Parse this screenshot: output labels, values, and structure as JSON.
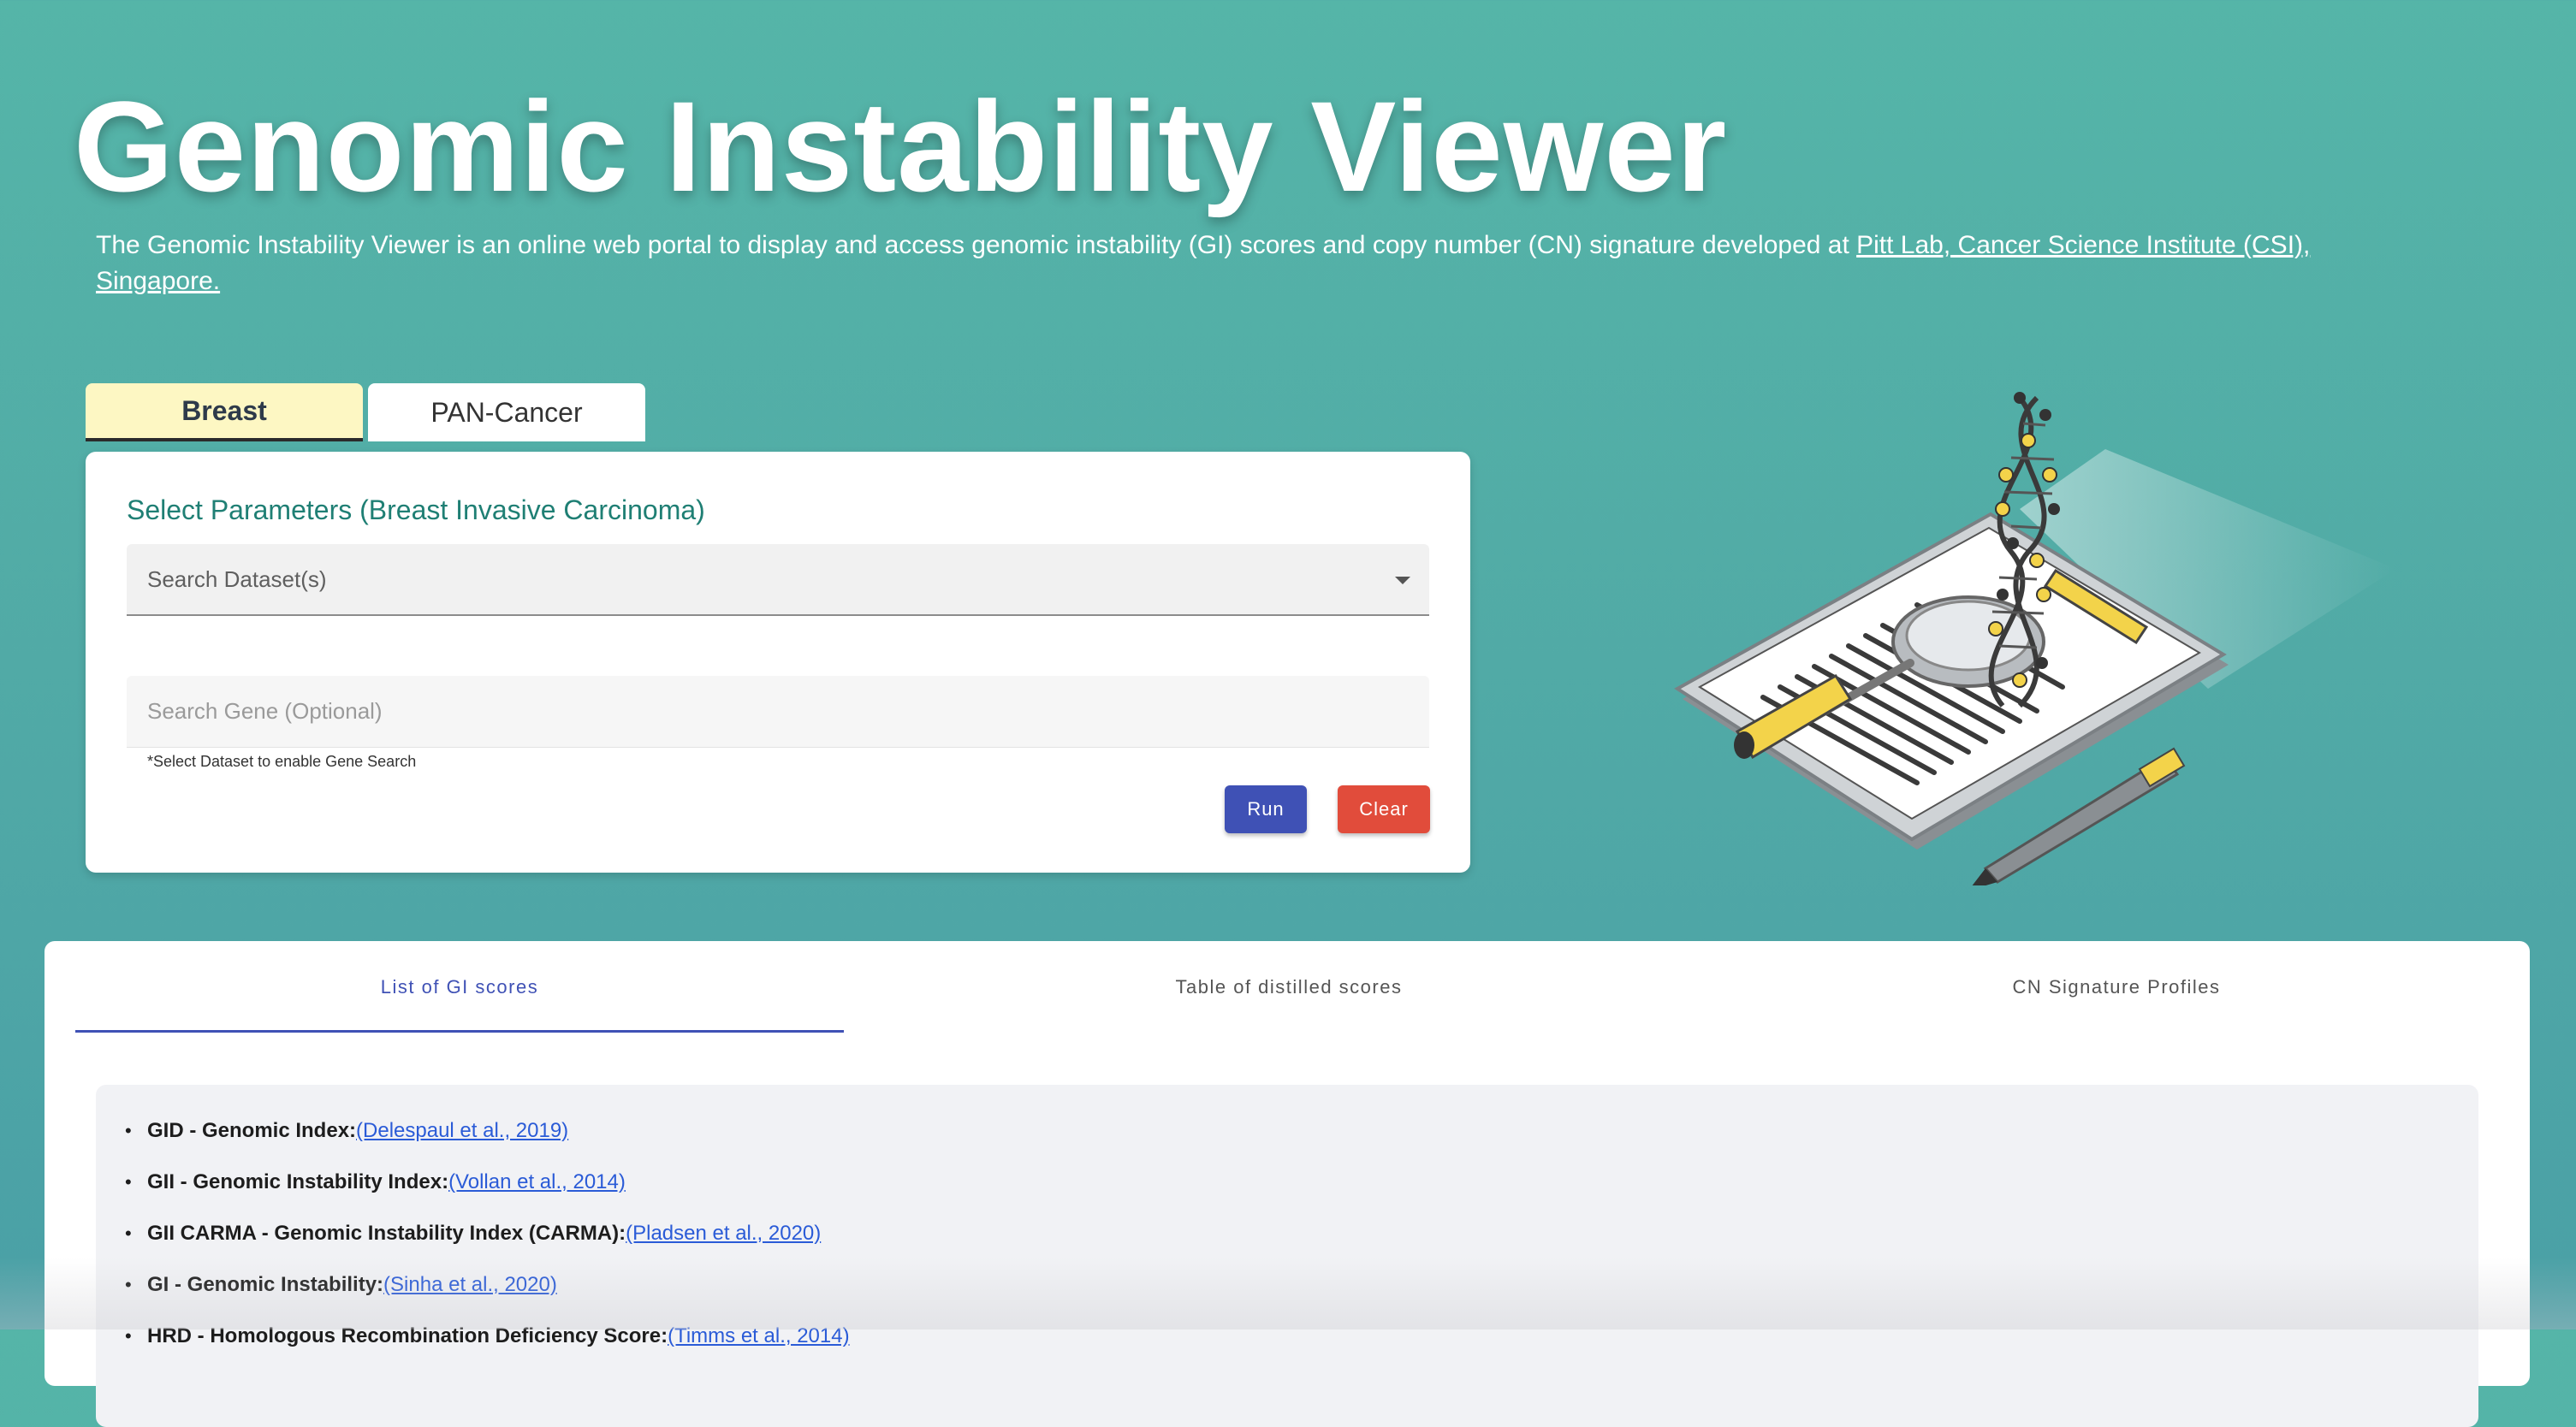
{
  "hero": {
    "title": "Genomic Instability Viewer",
    "description_text": "The Genomic Instability Viewer is an online web portal to display and access genomic instability (GI) scores and copy number (CN) signature developed at ",
    "link_text": "Pitt Lab, Cancer Science Institute (CSI), Singapore."
  },
  "tabs": [
    {
      "label": "Breast",
      "active": true
    },
    {
      "label": "PAN-Cancer",
      "active": false
    }
  ],
  "params": {
    "heading": "Select Parameters (Breast Invasive Carcinoma)",
    "dataset_placeholder": "Search Dataset(s)",
    "gene_placeholder": "Search Gene (Optional)",
    "hint": "*Select Dataset to enable Gene Search",
    "run_label": "Run",
    "clear_label": "Clear"
  },
  "results": {
    "tabs": [
      {
        "label": "List of GI scores",
        "active": true
      },
      {
        "label": "Table of distilled scores",
        "active": false
      },
      {
        "label": "CN Signature Profiles",
        "active": false
      }
    ],
    "items": [
      {
        "name": "GID - Genomic Index:",
        "ref": "(Delespaul et al., 2019)"
      },
      {
        "name": "GII - Genomic Instability Index:",
        "ref": "(Vollan et al., 2014)"
      },
      {
        "name": "GII CARMA - Genomic Instability Index (CARMA):",
        "ref": "(Pladsen et al., 2020)"
      },
      {
        "name": "GI - Genomic Instability:",
        "ref": "(Sinha et al., 2020)"
      },
      {
        "name": "HRD - Homologous Recombination Deficiency Score:",
        "ref": "(Timms et al., 2014)"
      }
    ]
  },
  "colors": {
    "background": "#51aaa6",
    "accent": "#3f51b5",
    "danger": "#e14c3b",
    "active_tab": "#fdf7c3",
    "heading": "#1f7f74"
  }
}
